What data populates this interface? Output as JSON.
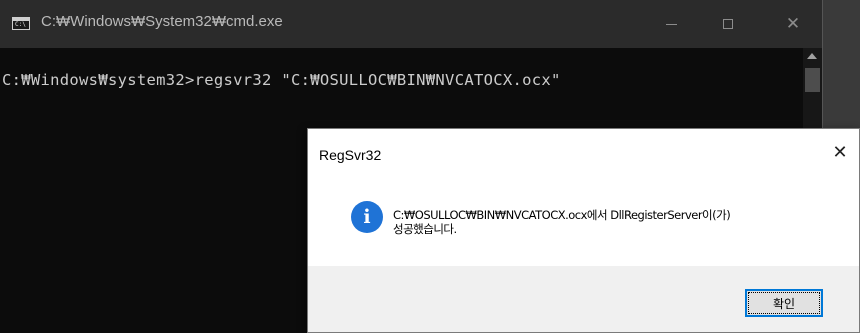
{
  "cmd": {
    "title": "C:₩Windows₩System32₩cmd.exe",
    "icon_prompt": "C:\\",
    "line": "C:₩Windows₩system32>regsvr32 \"C:₩OSULLOC₩BIN₩NVCATOCX.ocx\"",
    "close_glyph": "✕"
  },
  "dialog": {
    "title": "RegSvr32",
    "close_glyph": "✕",
    "icon_glyph": "i",
    "message_line1": "C:₩OSULLOC₩BIN₩NVCATOCX.ocx에서 DllRegisterServer이(가)",
    "message_line2": "성공했습니다.",
    "ok_label": "확인"
  },
  "colors": {
    "console_bg": "#0c0c0c",
    "titlebar_bg": "#2b2b2b",
    "info_icon_blue": "#1f73d6",
    "focus_border": "#0078d7"
  }
}
